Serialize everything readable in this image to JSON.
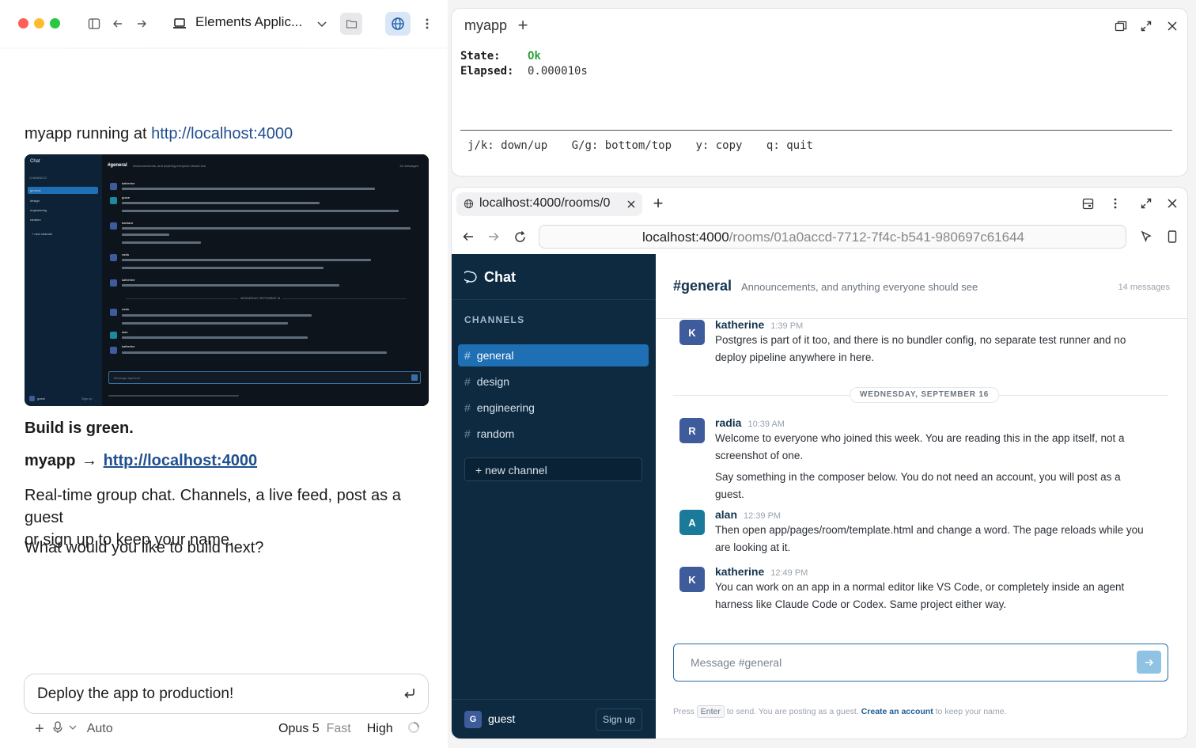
{
  "left": {
    "title": "Elements Applic...",
    "running_prefix": "myapp running at ",
    "running_link": "http://localhost:4000",
    "build_status": "Build is green.",
    "app_name": "myapp",
    "app_link": "http://localhost:4000",
    "description_line1": "Real-time group chat. Channels, a live feed, post as a guest",
    "description_line2": "or sign up to keep your name.",
    "question": "What would you like to build next?",
    "composer_text": "Deploy the app to production!",
    "mode": "Auto",
    "model": "Opus 5",
    "speed": "Fast",
    "effort": "High"
  },
  "thumbnail": {
    "chat_label": "Chat",
    "channels_label": "CHANNELS",
    "channels": [
      "general",
      "design",
      "engineering",
      "random"
    ],
    "new_channel": "+ new channel",
    "header": "#general",
    "header_desc": "Announcements, and anything everyone should see",
    "count": "14 messages",
    "day": "WEDNESDAY, SEPTEMBER 16",
    "authors": [
      "katherine",
      "grace",
      "barbara",
      "radia",
      "katherine",
      "radia",
      "alan",
      "katherine"
    ],
    "composer": "Message #general",
    "user": "guest",
    "signup": "Sign up"
  },
  "terminal": {
    "title": "myapp",
    "state_label": "State:",
    "state_value": "Ok",
    "elapsed_label": "Elapsed:",
    "elapsed_value": "0.000010s",
    "hints": [
      "j/k: down/up",
      "G/g: bottom/top",
      "y: copy",
      "q: quit"
    ],
    "colors": {
      "ok": "#2e9e3f"
    }
  },
  "browser": {
    "tab_title": "localhost:4000/rooms/0",
    "url_host": "localhost:4000",
    "url_path": "/rooms/01a0accd-7712-7f4c-b541-980697c61644"
  },
  "chat": {
    "brand": "Chat",
    "channels_label": "CHANNELS",
    "channels": [
      "general",
      "design",
      "engineering",
      "random"
    ],
    "active_channel": "general",
    "new_channel": "+ new channel",
    "channel_title": "#general",
    "channel_desc": "Announcements, and anything everyone should see",
    "message_count": "14 messages",
    "day_divider": "WEDNESDAY, SEPTEMBER 16",
    "messages": [
      {
        "initial": "K",
        "author": "katherine",
        "time": "1:39 PM",
        "lines": [
          "Postgres is part of it too, and there is no bundler config, no separate test runner and no",
          "deploy pipeline anywhere in here."
        ]
      },
      {
        "initial": "R",
        "author": "radia",
        "time": "10:39 AM",
        "lines": [
          "Welcome to everyone who joined this week. You are reading this in the app itself, not a",
          "screenshot of one."
        ],
        "extra_lines": [
          "Say something in the composer below. You do not need an account, you will post as a",
          "guest."
        ]
      },
      {
        "initial": "A",
        "author": "alan",
        "time": "12:39 PM",
        "lines": [
          "Then open app/pages/room/template.html and change a word. The page reloads while you",
          "are looking at it."
        ]
      },
      {
        "initial": "K",
        "author": "katherine",
        "time": "12:49 PM",
        "lines": [
          "You can work on an app in a normal editor like VS Code, or completely inside an agent",
          "harness like Claude Code or Codex. Same project either way."
        ]
      }
    ],
    "composer_placeholder": "Message #general",
    "footer_press": "Press",
    "footer_key": "Enter",
    "footer_mid": "to send. You are posting as a guest.",
    "footer_link": "Create an account",
    "footer_end": "to keep your name.",
    "user_initial": "G",
    "user_name": "guest",
    "signup": "Sign up",
    "colors": {
      "sidebar": "#0d2a40",
      "active": "#1f6fb5",
      "avatar_blue": "#3e5b9c",
      "avatar_teal": "#1b7a9a"
    }
  }
}
